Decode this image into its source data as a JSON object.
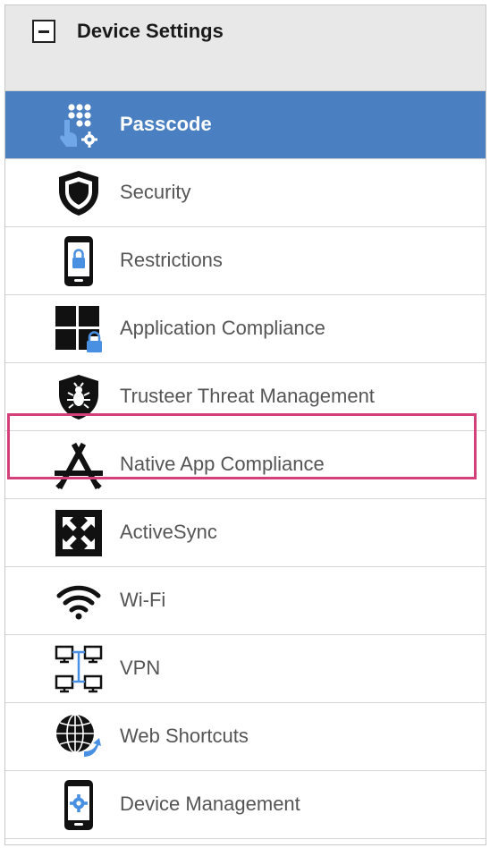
{
  "header": {
    "title": "Device Settings",
    "collapse_icon": "minus-square-icon"
  },
  "items": [
    {
      "label": "Passcode",
      "icon": "passcode-icon",
      "selected": true
    },
    {
      "label": "Security",
      "icon": "shield-icon",
      "selected": false
    },
    {
      "label": "Restrictions",
      "icon": "phone-lock-icon",
      "selected": false
    },
    {
      "label": "Application Compliance",
      "icon": "app-grid-lock-icon",
      "selected": false
    },
    {
      "label": "Trusteer Threat Management",
      "icon": "bug-shield-icon",
      "selected": false
    },
    {
      "label": "Native App Compliance",
      "icon": "app-store-icon",
      "selected": false
    },
    {
      "label": "ActiveSync",
      "icon": "exchange-icon",
      "selected": false,
      "highlighted": true
    },
    {
      "label": "Wi-Fi",
      "icon": "wifi-icon",
      "selected": false
    },
    {
      "label": "VPN",
      "icon": "network-icon",
      "selected": false
    },
    {
      "label": "Web Shortcuts",
      "icon": "globe-arrow-icon",
      "selected": false
    },
    {
      "label": "Device Management",
      "icon": "phone-gear-icon",
      "selected": false
    }
  ],
  "colors": {
    "selected_bg": "#4a7fc1",
    "highlight_border": "#d4417a",
    "header_bg": "#e8e8e8"
  }
}
